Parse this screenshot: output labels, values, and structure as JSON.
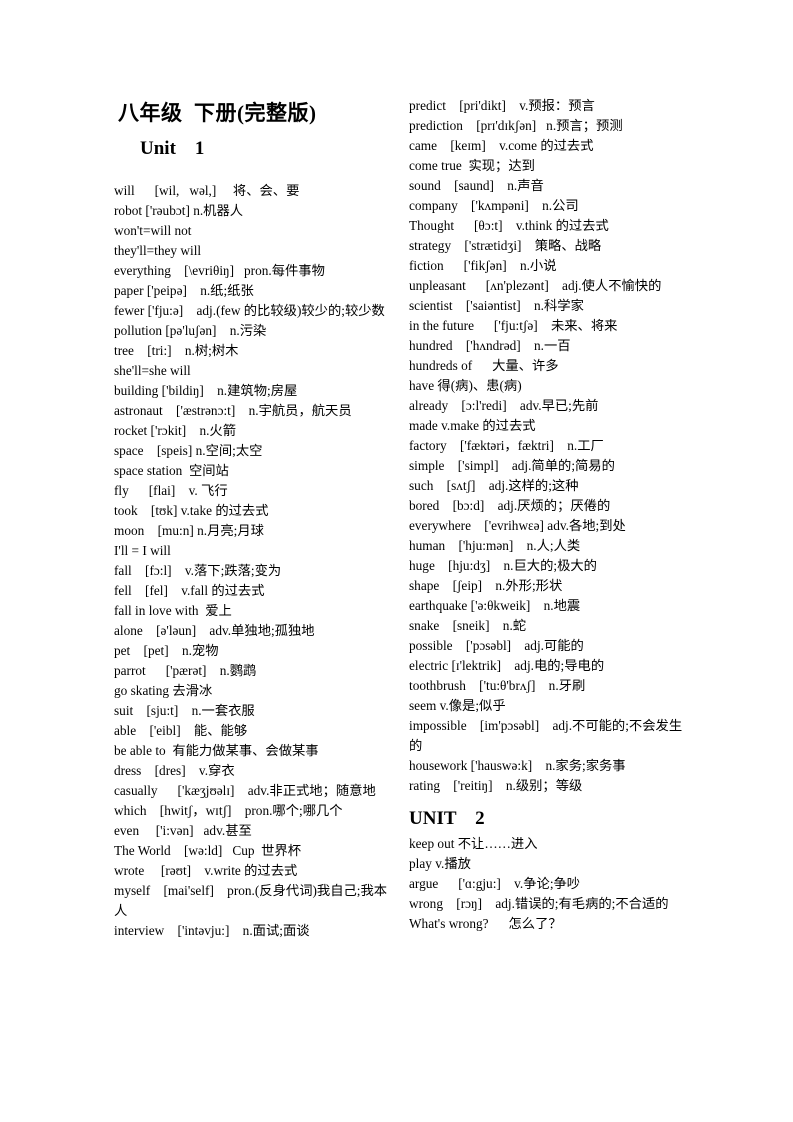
{
  "document": {
    "title": "八年级  下册(完整版)",
    "unit1_heading": "Unit    1",
    "unit2_heading": "UNIT    2"
  },
  "left_column": {
    "entries": [
      "will      [wil,   wəl,]     将、会、要",
      "robot ['rəubɔt] n.机器人",
      "won't=will not",
      "they'll=they will",
      "everything    [\\evriθiŋ]   pron.每件事物",
      "paper ['peipə]    n.纸;纸张",
      "fewer ['fju:ə]    adj.(few 的比较级)较少的;较少数",
      "pollution [pə'luʃən]    n.污染",
      "tree    [tri:]    n.树;树木",
      "she'll=she will",
      "building ['bildiŋ]    n.建筑物;房屋",
      "astronaut    ['æstrənɔ:t]    n.宇航员，航天员",
      "rocket ['rɔkit]    n.火箭",
      "space    [speis] n.空间;太空",
      "space station  空间站",
      "fly      [flai]    v. 飞行",
      "took    [tʊk] v.take 的过去式",
      "moon    [mu:n] n.月亮;月球",
      "I'll = I will",
      "fall    [fɔ:l]    v.落下;跌落;变为",
      "fell    [fel]    v.fall 的过去式",
      "fall in love with  爱上",
      "alone    [ə'ləun]    adv.单独地;孤独地",
      "pet    [pet]    n.宠物",
      "parrot      ['pærət]    n.鹦鹉",
      "go skating 去滑冰",
      "suit    [sju:t]    n.一套衣服",
      "able    ['eibl]    能、能够",
      "be able to  有能力做某事、会做某事",
      "dress    [dres]    v.穿衣",
      "casually      ['kæʒjʊəlɪ]    adv.非正式地；随意地",
      "which    [hwitʃ，wɪtʃ]    pron.哪个;哪几个",
      "even     ['i:vən]   adv.甚至",
      "The World    [wə:ld]   Cup  世界杯",
      "wrote     [rəʊt]    v.write 的过去式",
      "myself    [mai'self]    pron.(反身代词)我自己;我本人",
      "interview    ['intəvju:]    n.面试;面谈"
    ]
  },
  "right_column": {
    "entries_before_unit2": [
      "predict    [pri'dikt]    v.预报：预言",
      "prediction    [prɪ'dɪkʃən]   n.预言；预测",
      "came    [keɪm]    v.come 的过去式",
      "come true  实现；达到",
      "sound    [saund]    n.声音",
      "company    ['kʌmpəni]    n.公司",
      "Thought      [θɔ:t]    v.think 的过去式",
      "strategy    ['strætidʒi]    策略、战略",
      "fiction      ['fikʃən]    n.小说",
      "unpleasant      [ʌn'plezənt]    adj.使人不愉快的",
      "scientist    ['saiəntist]    n.科学家",
      "in the future      ['fju:tʃə]    未来、将来",
      "hundred    ['hʌndrəd]    n.一百",
      "hundreds of      大量、许多",
      "have 得(病)、患(病)",
      "already    [ɔ:l'redi]    adv.早已;先前",
      "made v.make 的过去式",
      "factory    ['fæktəri，fæktri]    n.工厂",
      "simple    ['simpl]    adj.简单的;简易的",
      "such    [sʌtʃ]    adj.这样的;这种",
      "bored    [bɔ:d]    adj.厌烦的；厌倦的",
      "everywhere    ['evrihwɛə] adv.各地;到处",
      "human    ['hju:mən]    n.人;人类",
      "huge    [hju:dʒ]    n.巨大的;极大的",
      "shape    [ʃeip]    n.外形;形状",
      "earthquake ['ə:θkweik]    n.地震",
      "snake    [sneik]    n.蛇",
      "possible    ['pɔsəbl]    adj.可能的",
      "electric [ɪ'lektrik]    adj.电的;导电的",
      "toothbrush    ['tu:θ'brʌʃ]    n.牙刷",
      "seem v.像是;似乎",
      "impossible    [im'pɔsəbl]    adj.不可能的;不会发生的",
      "housework ['hauswə:k]    n.家务;家务事",
      "rating    ['reitiŋ]    n.级别；等级"
    ],
    "entries_after_unit2": [
      "keep out 不让……进入",
      "play v.播放",
      "argue      ['ɑ:gju:]    v.争论;争吵",
      "wrong    [rɔŋ]    adj.错误的;有毛病的;不合适的",
      "What's wrong?      怎么了？"
    ]
  }
}
